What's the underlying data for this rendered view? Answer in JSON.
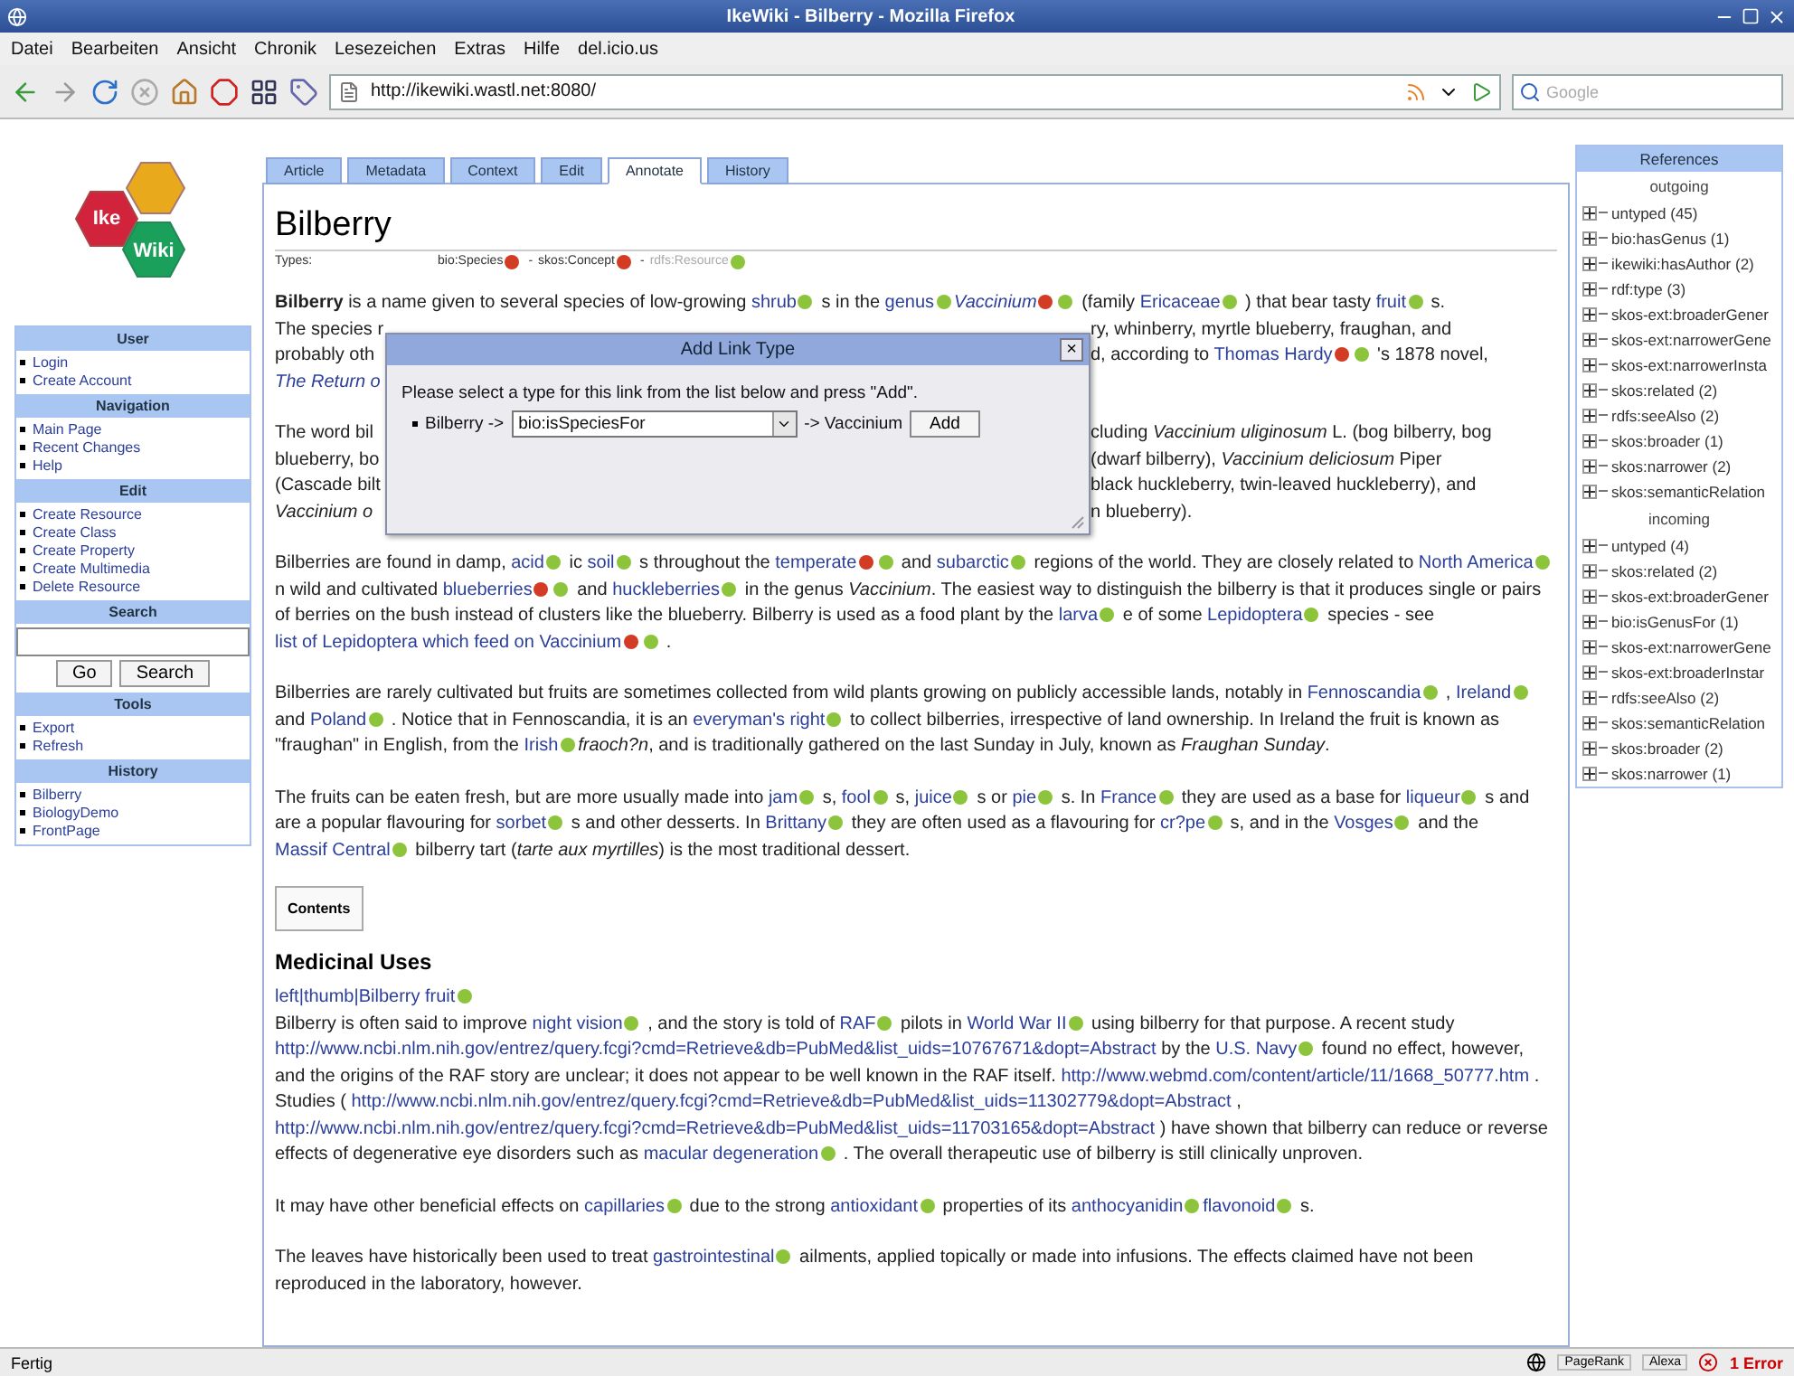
{
  "window": {
    "title": "IkeWiki - Bilberry - Mozilla Firefox"
  },
  "menu": [
    "Datei",
    "Bearbeiten",
    "Ansicht",
    "Chronik",
    "Lesezeichen",
    "Extras",
    "Hilfe",
    "del.icio.us"
  ],
  "toolbar": {
    "url": "http://ikewiki.wastl.net:8080/",
    "search_placeholder": "Google"
  },
  "logo": {
    "words": [
      "Ike",
      "Wiki"
    ]
  },
  "sidebar": {
    "sections": [
      {
        "title": "User",
        "kind": "links",
        "items": [
          "Login",
          "Create Account"
        ]
      },
      {
        "title": "Navigation",
        "kind": "links",
        "items": [
          "Main Page",
          "Recent Changes",
          "Help"
        ]
      },
      {
        "title": "Edit",
        "kind": "links",
        "items": [
          "Create Resource",
          "Create Class",
          "Create Property",
          "Create Multimedia",
          "Delete Resource"
        ]
      },
      {
        "title": "Search",
        "kind": "search",
        "buttons": [
          "Go",
          "Search"
        ]
      },
      {
        "title": "Tools",
        "kind": "links",
        "items": [
          "Export",
          "Refresh"
        ]
      },
      {
        "title": "History",
        "kind": "links",
        "items": [
          "Bilberry",
          "BiologyDemo",
          "FrontPage"
        ]
      }
    ]
  },
  "tabs": [
    {
      "label": "Article",
      "selected": false
    },
    {
      "label": "Metadata",
      "selected": false
    },
    {
      "label": "Context",
      "selected": false
    },
    {
      "label": "Edit",
      "selected": false
    },
    {
      "label": "Annotate",
      "selected": true
    },
    {
      "label": "History",
      "selected": false
    }
  ],
  "article": {
    "title": "Bilberry",
    "types_label": "Types:",
    "types_separator": "-",
    "types": [
      {
        "text": "bio:Species",
        "muted": false,
        "dots": [
          {
            "color": "#d23c24"
          }
        ]
      },
      {
        "text": "skos:Concept",
        "muted": false,
        "dots": [
          {
            "color": "#d23c24"
          }
        ]
      },
      {
        "text": "rdfs:Resource",
        "muted": true,
        "dots": [
          {
            "color": "#8cc43c"
          }
        ]
      }
    ],
    "covered": [
      {
        "lines": [
          {
            "left": [
              {
                "kind": "bold",
                "text": "Bilberry"
              },
              {
                "kind": "text",
                "text": " is a name given to several species of low-growing "
              },
              {
                "kind": "link",
                "text": "shrub",
                "dots": [
                  {
                    "color": "#8cc43c"
                  }
                ]
              },
              {
                "kind": "text",
                "text": " s in the "
              },
              {
                "kind": "link",
                "text": "genus",
                "dots": [
                  {
                    "color": "#8cc43c"
                  }
                ]
              },
              {
                "kind": "em-link",
                "text": "Vaccinium",
                "dots": [
                  {
                    "color": "#d23c24"
                  },
                  {
                    "color": "#8cc43c"
                  }
                ]
              },
              {
                "kind": "text",
                "text": " (family "
              },
              {
                "kind": "link",
                "text": "Ericaceae",
                "dots": [
                  {
                    "color": "#8cc43c"
                  }
                ]
              },
              {
                "kind": "text",
                "text": " ) that bear tasty "
              },
              {
                "kind": "link",
                "text": "fruit",
                "dots": [
                  {
                    "color": "#8cc43c"
                  }
                ]
              },
              {
                "kind": "text",
                "text": " s."
              }
            ]
          },
          {
            "left": [
              {
                "kind": "text",
                "text": "The species r"
              }
            ],
            "right": [
              {
                "kind": "text",
                "text": "ry, whinberry, myrtle blueberry, fraughan, and"
              }
            ]
          },
          {
            "left": [
              {
                "kind": "text",
                "text": "probably oth"
              }
            ],
            "right": [
              {
                "kind": "text",
                "text": "d, according to "
              },
              {
                "kind": "link",
                "text": "Thomas Hardy",
                "dots": [
                  {
                    "color": "#d23c24"
                  },
                  {
                    "color": "#8cc43c"
                  }
                ]
              },
              {
                "kind": "text",
                "text": " 's 1878 novel,"
              }
            ]
          },
          {
            "left": [
              {
                "kind": "em-link",
                "text": "The Return o"
              }
            ]
          }
        ]
      },
      {
        "lines": [
          {
            "left": [
              {
                "kind": "text",
                "text": "The word bil"
              }
            ],
            "right": [
              {
                "kind": "text",
                "text": "cluding "
              },
              {
                "kind": "em",
                "text": "Vaccinium uliginosum"
              },
              {
                "kind": "text",
                "text": " L. (bog bilberry, bog"
              }
            ]
          },
          {
            "left": [
              {
                "kind": "text",
                "text": "blueberry, bo"
              }
            ],
            "right": [
              {
                "kind": "text",
                "text": "(dwarf bilberry), "
              },
              {
                "kind": "em",
                "text": "Vaccinium deliciosum"
              },
              {
                "kind": "text",
                "text": " Piper"
              }
            ]
          },
          {
            "left": [
              {
                "kind": "text",
                "text": "(Cascade bilt"
              }
            ],
            "right": [
              {
                "kind": "text",
                "text": "black huckleberry, twin-leaved huckleberry), and"
              }
            ]
          },
          {
            "left": [
              {
                "kind": "em",
                "text": "Vaccinium o"
              }
            ],
            "right": [
              {
                "kind": "text",
                "text": "n blueberry)."
              }
            ]
          }
        ]
      }
    ],
    "paragraphs": [
      {
        "segments": [
          {
            "kind": "text",
            "text": "Bilberries are found in damp, "
          },
          {
            "kind": "link",
            "text": "acid",
            "dots": [
              {
                "color": "#8cc43c"
              }
            ]
          },
          {
            "kind": "text",
            "text": " ic "
          },
          {
            "kind": "link",
            "text": "soil",
            "dots": [
              {
                "color": "#8cc43c"
              }
            ]
          },
          {
            "kind": "text",
            "text": " s throughout the "
          },
          {
            "kind": "link",
            "text": "temperate",
            "dots": [
              {
                "color": "#d23c24"
              },
              {
                "color": "#8cc43c"
              }
            ]
          },
          {
            "kind": "text",
            "text": " and "
          },
          {
            "kind": "link",
            "text": "subarctic",
            "dots": [
              {
                "color": "#8cc43c"
              }
            ]
          },
          {
            "kind": "text",
            "text": " regions of the world. They are closely related to "
          },
          {
            "kind": "link",
            "text": "North America",
            "dots": [
              {
                "color": "#8cc43c"
              }
            ]
          },
          {
            "kind": "text",
            "text": " n wild and cultivated "
          },
          {
            "kind": "link",
            "text": "blueberries",
            "dots": [
              {
                "color": "#d23c24"
              },
              {
                "color": "#8cc43c"
              }
            ]
          },
          {
            "kind": "text",
            "text": " and "
          },
          {
            "kind": "link",
            "text": "huckleberries",
            "dots": [
              {
                "color": "#8cc43c"
              }
            ]
          },
          {
            "kind": "text",
            "text": " in the genus "
          },
          {
            "kind": "em",
            "text": "Vaccinium"
          },
          {
            "kind": "text",
            "text": ". The easiest way to distinguish the bilberry is that it produces single or pairs of berries on the bush instead of clusters like the blueberry. Bilberry is used as a food plant by the "
          },
          {
            "kind": "link",
            "text": "larva",
            "dots": [
              {
                "color": "#8cc43c"
              }
            ]
          },
          {
            "kind": "text",
            "text": " e of some "
          },
          {
            "kind": "link",
            "text": "Lepidoptera",
            "dots": [
              {
                "color": "#8cc43c"
              }
            ]
          },
          {
            "kind": "text",
            "text": " species - see "
          },
          {
            "kind": "link",
            "text": "list of Lepidoptera which feed on Vaccinium",
            "dots": [
              {
                "color": "#d23c24"
              },
              {
                "color": "#8cc43c"
              }
            ]
          },
          {
            "kind": "text",
            "text": " ."
          }
        ]
      },
      {
        "segments": [
          {
            "kind": "text",
            "text": "Bilberries are rarely cultivated but fruits are sometimes collected from wild plants growing on publicly accessible lands, notably in "
          },
          {
            "kind": "link",
            "text": "Fennoscandia",
            "dots": [
              {
                "color": "#8cc43c"
              }
            ]
          },
          {
            "kind": "text",
            "text": " , "
          },
          {
            "kind": "link",
            "text": "Ireland",
            "dots": [
              {
                "color": "#8cc43c"
              }
            ]
          },
          {
            "kind": "text",
            "text": " and "
          },
          {
            "kind": "link",
            "text": "Poland",
            "dots": [
              {
                "color": "#8cc43c"
              }
            ]
          },
          {
            "kind": "text",
            "text": " . Notice that in Fennoscandia, it is an "
          },
          {
            "kind": "link",
            "text": "everyman's right",
            "dots": [
              {
                "color": "#8cc43c"
              }
            ]
          },
          {
            "kind": "text",
            "text": " to collect bilberries, irrespective of land ownership. In Ireland the fruit is known as \"fraughan\" in English, from the "
          },
          {
            "kind": "link",
            "text": "Irish",
            "dots": [
              {
                "color": "#8cc43c"
              }
            ]
          },
          {
            "kind": "em",
            "text": "fraoch?n"
          },
          {
            "kind": "text",
            "text": ", and is traditionally gathered on the last Sunday in July, known as "
          },
          {
            "kind": "em",
            "text": "Fraughan Sunday"
          },
          {
            "kind": "text",
            "text": "."
          }
        ]
      },
      {
        "segments": [
          {
            "kind": "text",
            "text": "The fruits can be eaten fresh, but are more usually made into "
          },
          {
            "kind": "link",
            "text": "jam",
            "dots": [
              {
                "color": "#8cc43c"
              }
            ]
          },
          {
            "kind": "text",
            "text": " s, "
          },
          {
            "kind": "link",
            "text": "fool",
            "dots": [
              {
                "color": "#8cc43c"
              }
            ]
          },
          {
            "kind": "text",
            "text": " s, "
          },
          {
            "kind": "link",
            "text": "juice",
            "dots": [
              {
                "color": "#8cc43c"
              }
            ]
          },
          {
            "kind": "text",
            "text": " s or "
          },
          {
            "kind": "link",
            "text": "pie",
            "dots": [
              {
                "color": "#8cc43c"
              }
            ]
          },
          {
            "kind": "text",
            "text": " s. In "
          },
          {
            "kind": "link",
            "text": "France",
            "dots": [
              {
                "color": "#8cc43c"
              }
            ]
          },
          {
            "kind": "text",
            "text": " they are used as a base for "
          },
          {
            "kind": "link",
            "text": "liqueur",
            "dots": [
              {
                "color": "#8cc43c"
              }
            ]
          },
          {
            "kind": "text",
            "text": " s and are a popular flavouring for "
          },
          {
            "kind": "link",
            "text": "sorbet",
            "dots": [
              {
                "color": "#8cc43c"
              }
            ]
          },
          {
            "kind": "text",
            "text": " s and other desserts. In "
          },
          {
            "kind": "link",
            "text": "Brittany",
            "dots": [
              {
                "color": "#8cc43c"
              }
            ]
          },
          {
            "kind": "text",
            "text": " they are often used as a flavouring for "
          },
          {
            "kind": "link",
            "text": "cr?pe",
            "dots": [
              {
                "color": "#8cc43c"
              }
            ]
          },
          {
            "kind": "text",
            "text": " s, and in the "
          },
          {
            "kind": "link",
            "text": "Vosges",
            "dots": [
              {
                "color": "#8cc43c"
              }
            ]
          },
          {
            "kind": "text",
            "text": " and the "
          },
          {
            "kind": "link",
            "text": "Massif Central",
            "dots": [
              {
                "color": "#8cc43c"
              }
            ]
          },
          {
            "kind": "text",
            "text": " bilberry tart ("
          },
          {
            "kind": "em",
            "text": "tarte aux myrtilles"
          },
          {
            "kind": "text",
            "text": ") is the most traditional dessert."
          }
        ]
      }
    ],
    "contents": "Contents",
    "section": {
      "heading": "Medicinal Uses",
      "caption": {
        "text": "left|thumb|Bilberry fruit",
        "dots": [
          {
            "color": "#8cc43c"
          }
        ]
      },
      "paragraphs": [
        {
          "segments": [
            {
              "kind": "text",
              "text": "Bilberry is often said to improve "
            },
            {
              "kind": "link",
              "text": "night vision",
              "dots": [
                {
                  "color": "#8cc43c"
                }
              ]
            },
            {
              "kind": "text",
              "text": " , and the story is told of "
            },
            {
              "kind": "link",
              "text": "RAF",
              "dots": [
                {
                  "color": "#8cc43c"
                }
              ]
            },
            {
              "kind": "text",
              "text": " pilots in "
            },
            {
              "kind": "link",
              "text": "World War II",
              "dots": [
                {
                  "color": "#8cc43c"
                }
              ]
            },
            {
              "kind": "text",
              "text": " using bilberry for that purpose. A recent study "
            },
            {
              "kind": "link",
              "text": "http://www.ncbi.nlm.nih.gov/entrez/query.fcgi?cmd=Retrieve&db=PubMed&list_uids=10767671&dopt=Abstract"
            },
            {
              "kind": "text",
              "text": " by the "
            },
            {
              "kind": "link",
              "text": "U.S. Navy",
              "dots": [
                {
                  "color": "#8cc43c"
                }
              ]
            },
            {
              "kind": "text",
              "text": " found no effect, however, and the origins of the RAF story are unclear; it does not appear to be well known in the RAF itself. "
            },
            {
              "kind": "link",
              "text": "http://www.webmd.com/content/article/11/1668_50777.htm"
            },
            {
              "kind": "text",
              "text": " . Studies ( "
            },
            {
              "kind": "link",
              "text": "http://www.ncbi.nlm.nih.gov/entrez/query.fcgi?cmd=Retrieve&db=PubMed&list_uids=11302779&dopt=Abstract"
            },
            {
              "kind": "text",
              "text": " , "
            },
            {
              "kind": "link",
              "text": "http://www.ncbi.nlm.nih.gov/entrez/query.fcgi?cmd=Retrieve&db=PubMed&list_uids=11703165&dopt=Abstract"
            },
            {
              "kind": "text",
              "text": " ) have shown that bilberry can reduce or reverse effects of degenerative eye disorders such as "
            },
            {
              "kind": "link",
              "text": "macular degeneration",
              "dots": [
                {
                  "color": "#8cc43c"
                }
              ]
            },
            {
              "kind": "text",
              "text": " . The overall therapeutic use of bilberry is still clinically unproven."
            }
          ]
        },
        {
          "segments": [
            {
              "kind": "text",
              "text": "It may have other beneficial effects on "
            },
            {
              "kind": "link",
              "text": "capillaries",
              "dots": [
                {
                  "color": "#8cc43c"
                }
              ]
            },
            {
              "kind": "text",
              "text": " due to the strong "
            },
            {
              "kind": "link",
              "text": "antioxidant",
              "dots": [
                {
                  "color": "#8cc43c"
                }
              ]
            },
            {
              "kind": "text",
              "text": " properties of its "
            },
            {
              "kind": "link",
              "text": "anthocyanidin",
              "dots": [
                {
                  "color": "#8cc43c"
                }
              ]
            },
            {
              "kind": "link",
              "text": "flavonoid",
              "dots": [
                {
                  "color": "#8cc43c"
                }
              ]
            },
            {
              "kind": "text",
              "text": " s."
            }
          ]
        },
        {
          "segments": [
            {
              "kind": "text",
              "text": "The leaves have historically been used to treat "
            },
            {
              "kind": "link",
              "text": "gastrointestinal",
              "dots": [
                {
                  "color": "#8cc43c"
                }
              ]
            },
            {
              "kind": "text",
              "text": " ailments, applied topically or made into infusions. The effects claimed have not been reproduced in the laboratory, however."
            }
          ]
        }
      ]
    }
  },
  "dialog": {
    "title": "Add Link Type",
    "close": "×",
    "prompt": "Please select a type for this link from the list below and press \"Add\".",
    "from": "Bilberry ->",
    "type_value": "bio:isSpeciesFor",
    "to": "-> Vaccinium",
    "button": "Add"
  },
  "references": {
    "title": "References",
    "groups": [
      {
        "label": "outgoing",
        "items": [
          {
            "text": "untyped (45)",
            "expanded": false
          },
          {
            "text": "bio:hasGenus (1)",
            "expanded": false
          },
          {
            "text": "ikewiki:hasAuthor (2)",
            "expanded": false
          },
          {
            "text": "rdf:type (3)",
            "expanded": false
          },
          {
            "text": "skos-ext:broaderGener",
            "expanded": false
          },
          {
            "text": "skos-ext:narrowerGene",
            "expanded": false
          },
          {
            "text": "skos-ext:narrowerInsta",
            "expanded": false
          },
          {
            "text": "skos:related (2)",
            "expanded": false
          },
          {
            "text": "rdfs:seeAlso (2)",
            "expanded": false
          },
          {
            "text": "skos:broader (1)",
            "expanded": false
          },
          {
            "text": "skos:narrower (2)",
            "expanded": false
          },
          {
            "text": "skos:semanticRelation",
            "expanded": false
          }
        ]
      },
      {
        "label": "incoming",
        "items": [
          {
            "text": "untyped (4)",
            "expanded": false
          },
          {
            "text": "skos:related (2)",
            "expanded": false
          },
          {
            "text": "skos-ext:broaderGener",
            "expanded": false
          },
          {
            "text": "bio:isGenusFor (1)",
            "expanded": false
          },
          {
            "text": "skos-ext:narrowerGene",
            "expanded": false
          },
          {
            "text": "skos-ext:broaderInstar",
            "expanded": false
          },
          {
            "text": "rdfs:seeAlso (2)",
            "expanded": false
          },
          {
            "text": "skos:semanticRelation",
            "expanded": false
          },
          {
            "text": "skos:broader (2)",
            "expanded": false
          },
          {
            "text": "skos:narrower (1)",
            "expanded": false
          }
        ]
      }
    ]
  },
  "status_bar": {
    "text": "Fertig",
    "items": [
      "PageRank",
      "Alexa"
    ],
    "error": "1 Error"
  }
}
